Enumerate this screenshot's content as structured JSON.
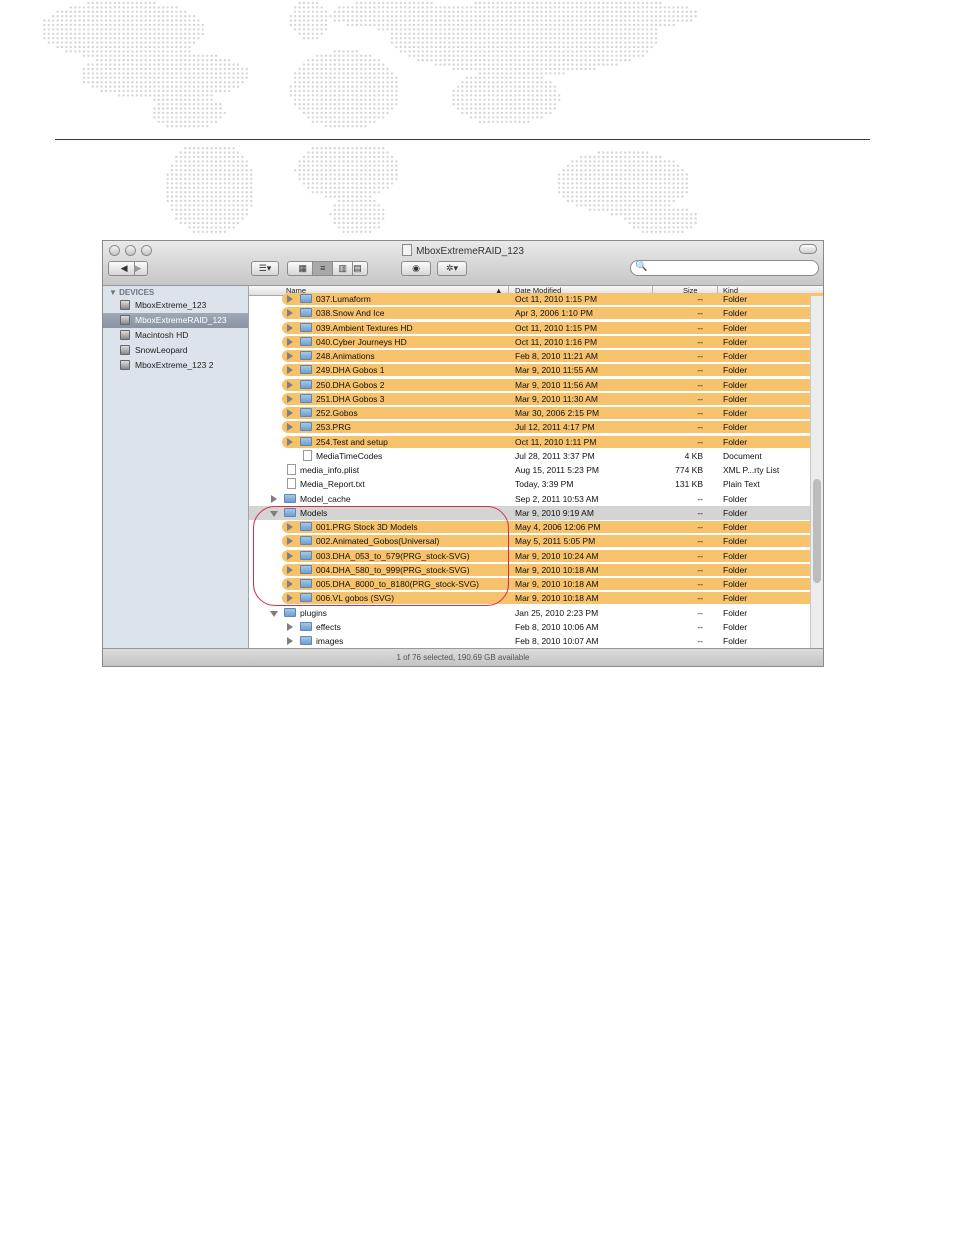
{
  "window": {
    "title": "MboxExtremeRAID_123",
    "status": "1 of 76 selected, 190.69 GB available",
    "search_placeholder": ""
  },
  "toolbar": {
    "back_label": "◀",
    "forward_label": "▶",
    "arrange_label": "☰▾",
    "view_icon_label": "▦",
    "view_list_label": "≡",
    "view_column_label": "▥",
    "view_coverflow_label": "▤",
    "quicklook_label": "◉",
    "action_label": "✲▾",
    "search_icon": "🔍"
  },
  "sidebar": {
    "header": "▼ DEVICES",
    "items": [
      {
        "label": "MboxExtreme_123",
        "selected": false
      },
      {
        "label": "MboxExtremeRAID_123",
        "selected": true
      },
      {
        "label": "Macintosh HD",
        "selected": false
      },
      {
        "label": "SnowLeopard",
        "selected": false
      },
      {
        "label": "MboxExtreme_123 2",
        "selected": false
      }
    ]
  },
  "columns": {
    "name": "Name",
    "sort_indicator": "▲",
    "date": "Date Modified",
    "size": "Size",
    "kind": "Kind"
  },
  "rows": [
    {
      "name": "037.Lumaform",
      "date": "Oct 11, 2010 1:15 PM",
      "size": "--",
      "kind": "Folder",
      "level": 1,
      "type": "folder",
      "highlight": true,
      "disclosure": "closed"
    },
    {
      "name": "038.Snow And Ice",
      "date": "Apr 3, 2006 1:10 PM",
      "size": "--",
      "kind": "Folder",
      "level": 1,
      "type": "folder",
      "highlight": true,
      "disclosure": "closed"
    },
    {
      "name": "039.Ambient Textures HD",
      "date": "Oct 11, 2010 1:15 PM",
      "size": "--",
      "kind": "Folder",
      "level": 1,
      "type": "folder",
      "highlight": true,
      "disclosure": "closed"
    },
    {
      "name": "040.Cyber Journeys HD",
      "date": "Oct 11, 2010 1:16 PM",
      "size": "--",
      "kind": "Folder",
      "level": 1,
      "type": "folder",
      "highlight": true,
      "disclosure": "closed"
    },
    {
      "name": "248.Animations",
      "date": "Feb 8, 2010 11:21 AM",
      "size": "--",
      "kind": "Folder",
      "level": 1,
      "type": "folder",
      "highlight": true,
      "disclosure": "closed"
    },
    {
      "name": "249.DHA Gobos 1",
      "date": "Mar 9, 2010 11:55 AM",
      "size": "--",
      "kind": "Folder",
      "level": 1,
      "type": "folder",
      "highlight": true,
      "disclosure": "closed"
    },
    {
      "name": "250.DHA Gobos 2",
      "date": "Mar 9, 2010 11:56 AM",
      "size": "--",
      "kind": "Folder",
      "level": 1,
      "type": "folder",
      "highlight": true,
      "disclosure": "closed"
    },
    {
      "name": "251.DHA Gobos 3",
      "date": "Mar 9, 2010 11:30 AM",
      "size": "--",
      "kind": "Folder",
      "level": 1,
      "type": "folder",
      "highlight": true,
      "disclosure": "closed"
    },
    {
      "name": "252.Gobos",
      "date": "Mar 30, 2006 2:15 PM",
      "size": "--",
      "kind": "Folder",
      "level": 1,
      "type": "folder",
      "highlight": true,
      "disclosure": "closed"
    },
    {
      "name": "253.PRG",
      "date": "Jul 12, 2011 4:17 PM",
      "size": "--",
      "kind": "Folder",
      "level": 1,
      "type": "folder",
      "highlight": true,
      "disclosure": "closed"
    },
    {
      "name": "254.Test and setup",
      "date": "Oct 11, 2010 1:11 PM",
      "size": "--",
      "kind": "Folder",
      "level": 1,
      "type": "folder",
      "highlight": true,
      "disclosure": "closed"
    },
    {
      "name": "MediaTimeCodes",
      "date": "Jul 28, 2011 3:37 PM",
      "size": "4 KB",
      "kind": "Document",
      "level": 1,
      "type": "doc",
      "highlight": false,
      "disclosure": "none"
    },
    {
      "name": "media_info.plist",
      "date": "Aug 15, 2011 5:23 PM",
      "size": "774 KB",
      "kind": "XML P...rty List",
      "level": 0,
      "type": "doc",
      "highlight": false,
      "disclosure": "none"
    },
    {
      "name": "Media_Report.txt",
      "date": "Today, 3:39 PM",
      "size": "131 KB",
      "kind": "Plain Text",
      "level": 0,
      "type": "doc",
      "highlight": false,
      "disclosure": "none"
    },
    {
      "name": "Model_cache",
      "date": "Sep 2, 2011 10:53 AM",
      "size": "--",
      "kind": "Folder",
      "level": 0,
      "type": "folder",
      "highlight": false,
      "disclosure": "closed"
    },
    {
      "name": "Models",
      "date": "Mar 9, 2010 9:19 AM",
      "size": "--",
      "kind": "Folder",
      "level": 0,
      "type": "folder",
      "highlight": false,
      "disclosure": "open",
      "selected": true
    },
    {
      "name": "001.PRG Stock 3D Models",
      "date": "May 4, 2006 12:06 PM",
      "size": "--",
      "kind": "Folder",
      "level": 1,
      "type": "folder",
      "highlight": true,
      "disclosure": "closed"
    },
    {
      "name": "002.Animated_Gobos(Universal)",
      "date": "May 5, 2011 5:05 PM",
      "size": "--",
      "kind": "Folder",
      "level": 1,
      "type": "folder",
      "highlight": true,
      "disclosure": "closed"
    },
    {
      "name": "003.DHA_053_to_579(PRG_stock-SVG)",
      "date": "Mar 9, 2010 10:24 AM",
      "size": "--",
      "kind": "Folder",
      "level": 1,
      "type": "folder",
      "highlight": true,
      "disclosure": "closed"
    },
    {
      "name": "004.DHA_580_to_999(PRG_stock-SVG)",
      "date": "Mar 9, 2010 10:18 AM",
      "size": "--",
      "kind": "Folder",
      "level": 1,
      "type": "folder",
      "highlight": true,
      "disclosure": "closed"
    },
    {
      "name": "005.DHA_8000_to_8180(PRG_stock-SVG)",
      "date": "Mar 9, 2010 10:18 AM",
      "size": "--",
      "kind": "Folder",
      "level": 1,
      "type": "folder",
      "highlight": true,
      "disclosure": "closed"
    },
    {
      "name": "006.VL gobos (SVG)",
      "date": "Mar 9, 2010 10:18 AM",
      "size": "--",
      "kind": "Folder",
      "level": 1,
      "type": "folder",
      "highlight": true,
      "disclosure": "closed"
    },
    {
      "name": "plugins",
      "date": "Jan 25, 2010 2:23 PM",
      "size": "--",
      "kind": "Folder",
      "level": 0,
      "type": "folder",
      "highlight": false,
      "disclosure": "open"
    },
    {
      "name": "effects",
      "date": "Feb 8, 2010 10:06 AM",
      "size": "--",
      "kind": "Folder",
      "level": 1,
      "type": "folder",
      "highlight": false,
      "disclosure": "closed"
    },
    {
      "name": "images",
      "date": "Feb 8, 2010 10:07 AM",
      "size": "--",
      "kind": "Folder",
      "level": 1,
      "type": "folder",
      "highlight": false,
      "disclosure": "closed"
    }
  ],
  "colors": {
    "highlight": "#f6c26c",
    "callout": "#d23048",
    "map_dots": "#d6d6d6"
  }
}
